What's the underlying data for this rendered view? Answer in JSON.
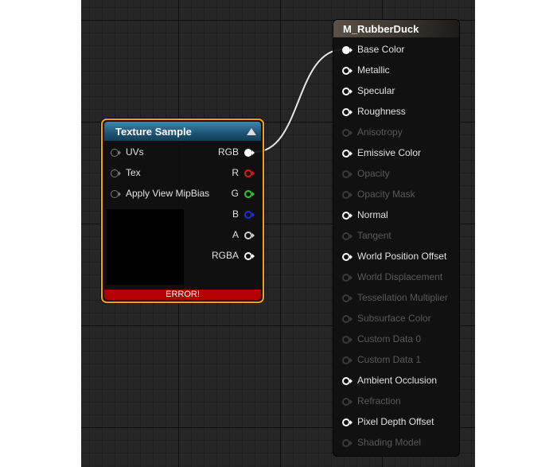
{
  "texture_sample": {
    "title": "Texture Sample",
    "inputs": [
      {
        "label": "UVs"
      },
      {
        "label": "Tex"
      },
      {
        "label": "Apply View MipBias"
      }
    ],
    "outputs": [
      {
        "label": "RGB",
        "color": "#ffffff"
      },
      {
        "label": "R",
        "color": "#e01818"
      },
      {
        "label": "G",
        "color": "#22cc22"
      },
      {
        "label": "B",
        "color": "#1a2ee6"
      },
      {
        "label": "A",
        "color": "#cfcfcf"
      },
      {
        "label": "RGBA",
        "color": "#ffffff"
      }
    ],
    "error": "ERROR!",
    "colors": {
      "border": "#f3a20a",
      "header": "#1d5474",
      "error_bar": "#b40000"
    }
  },
  "material": {
    "title": "M_RubberDuck",
    "pins": [
      {
        "label": "Base Color",
        "enabled": true,
        "connected": true
      },
      {
        "label": "Metallic",
        "enabled": true,
        "connected": false
      },
      {
        "label": "Specular",
        "enabled": true,
        "connected": false
      },
      {
        "label": "Roughness",
        "enabled": true,
        "connected": false
      },
      {
        "label": "Anisotropy",
        "enabled": false,
        "connected": false
      },
      {
        "label": "Emissive Color",
        "enabled": true,
        "connected": false
      },
      {
        "label": "Opacity",
        "enabled": false,
        "connected": false
      },
      {
        "label": "Opacity Mask",
        "enabled": false,
        "connected": false
      },
      {
        "label": "Normal",
        "enabled": true,
        "connected": false
      },
      {
        "label": "Tangent",
        "enabled": false,
        "connected": false
      },
      {
        "label": "World Position Offset",
        "enabled": true,
        "connected": false
      },
      {
        "label": "World Displacement",
        "enabled": false,
        "connected": false
      },
      {
        "label": "Tessellation Multiplier",
        "enabled": false,
        "connected": false
      },
      {
        "label": "Subsurface Color",
        "enabled": false,
        "connected": false
      },
      {
        "label": "Custom Data 0",
        "enabled": false,
        "connected": false
      },
      {
        "label": "Custom Data 1",
        "enabled": false,
        "connected": false
      },
      {
        "label": "Ambient Occlusion",
        "enabled": true,
        "connected": false
      },
      {
        "label": "Refraction",
        "enabled": false,
        "connected": false
      },
      {
        "label": "Pixel Depth Offset",
        "enabled": true,
        "connected": false
      },
      {
        "label": "Shading Model",
        "enabled": false,
        "connected": false
      }
    ]
  },
  "connections": [
    {
      "from": "Texture Sample.RGB",
      "to": "M_RubberDuck.Base Color"
    }
  ]
}
